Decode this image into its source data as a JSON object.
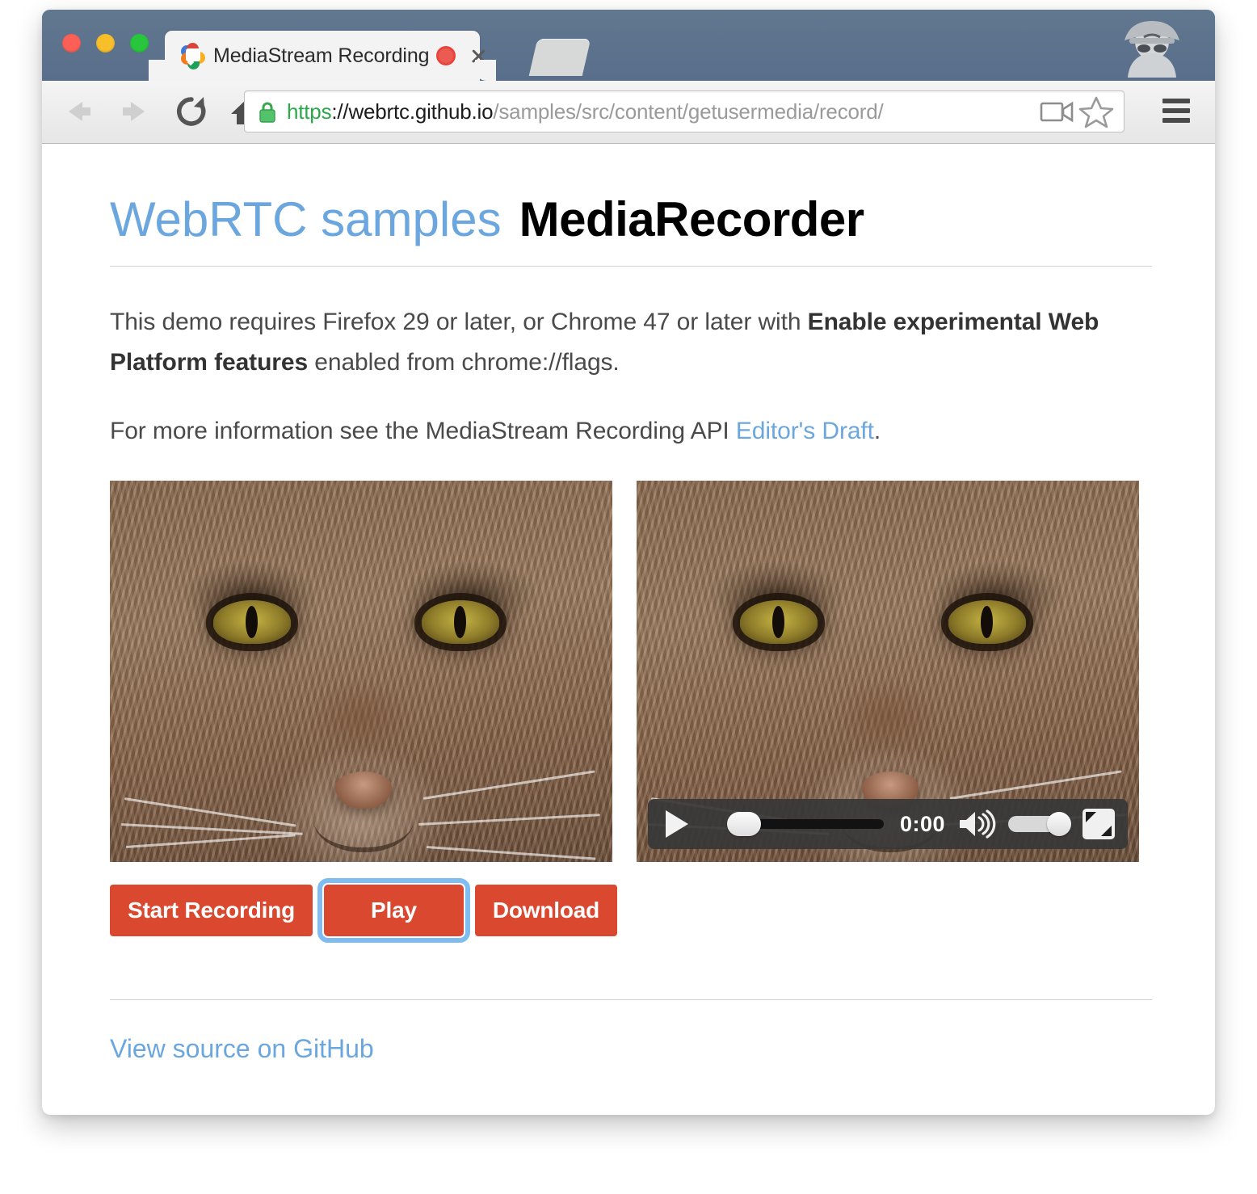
{
  "window": {
    "traffic_lights": [
      "close",
      "minimize",
      "maximize"
    ],
    "colors": {
      "titlebar": "#5d7391",
      "accent_link": "#6ba7de",
      "button_red": "#d9482f",
      "focus_ring": "#7fbcf0",
      "ssl_green": "#2ba84a"
    }
  },
  "tab": {
    "title": "MediaStream Recording",
    "favicon_name": "webrtc-logo-icon",
    "recording_indicator": "recording-dot-icon",
    "close_label": "×",
    "new_tab_label": "+"
  },
  "toolbar": {
    "back_label": "←",
    "forward_label": "→",
    "reload_label": "↻",
    "home_label": "⌂",
    "url": {
      "scheme": "https",
      "host": "://webrtc.github.io",
      "path": "/samples/src/content/getusermedia/record/",
      "full": "https://webrtc.github.io/samples/src/content/getusermedia/record/"
    },
    "lock_name": "ssl-lock-icon",
    "camera_icon_name": "camera-permission-icon",
    "bookmark_icon_name": "star-bookmark-icon",
    "menu_icon_name": "hamburger-menu-icon",
    "profile_icon_name": "incognito-avatar-icon"
  },
  "page": {
    "heading": {
      "samples_link": "WebRTC samples",
      "title": "MediaRecorder"
    },
    "paragraph1": {
      "part1": "This demo requires Firefox 29 or later, or Chrome 47 or later with ",
      "bold": "Enable experimental Web Platform features",
      "part2": " enabled from chrome://flags."
    },
    "paragraph2": {
      "part1": "For more information see the MediaStream Recording API ",
      "link": "Editor's Draft",
      "part2": "."
    },
    "videos": {
      "live_label": "live-camera-preview",
      "recorded_label": "recorded-video-playback"
    },
    "player": {
      "play_label": "play",
      "time": "0:00",
      "volume_label": "volume",
      "fullscreen_label": "fullscreen"
    },
    "buttons": {
      "start_recording": "Start Recording",
      "play": "Play",
      "download": "Download"
    },
    "footer_link": "View source on GitHub"
  }
}
